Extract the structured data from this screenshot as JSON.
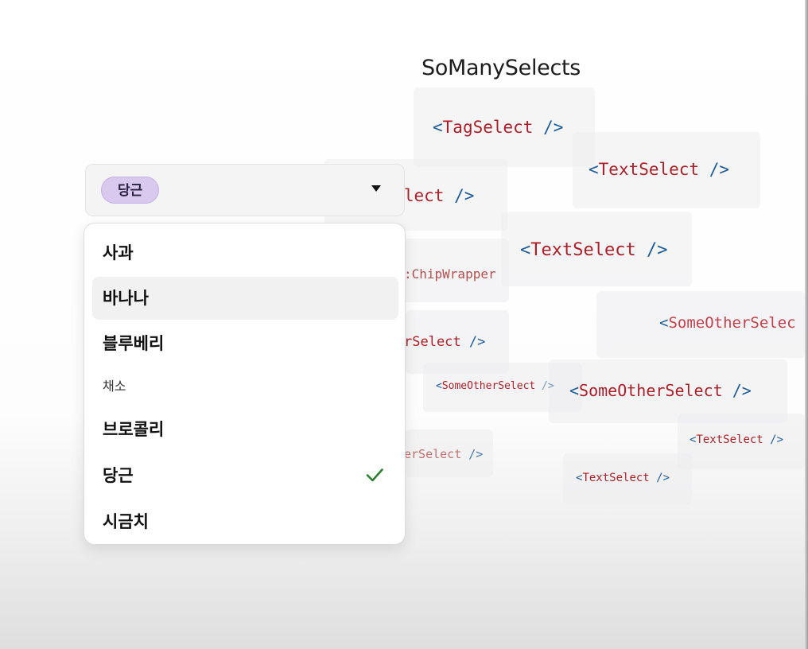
{
  "page_title": "SoManySelects",
  "select": {
    "selected_chip": "당근",
    "menu_items": [
      {
        "label": "사과",
        "kind": "option",
        "selected": false
      },
      {
        "label": "바나나",
        "kind": "option",
        "selected": false
      },
      {
        "label": "블루베리",
        "kind": "option",
        "selected": false
      },
      {
        "label": "채소",
        "kind": "group",
        "selected": false
      },
      {
        "label": "브로콜리",
        "kind": "option",
        "selected": false
      },
      {
        "label": "당근",
        "kind": "option",
        "selected": true
      },
      {
        "label": "시금치",
        "kind": "option",
        "selected": false
      }
    ],
    "hovered_item": "바나나"
  },
  "code_labels": {
    "open": "<",
    "close": " />",
    "tag_select": "TagSelect",
    "text_select": "TextSelect",
    "chip_wrapper": "ChipWrapper",
    "some_other_select": "SomeOtherSelect",
    "some_other_selec_cut": "SomeOtherSelec",
    "cut_er_select": "rSelect",
    "cut_er_select_2": "erSelect",
    "chip_wrapper_cut": ":ChipWrapper"
  },
  "colors": {
    "bracket": "#1f5c94",
    "tag_name": "#a8202a",
    "chip_bg": "#d9c9ef",
    "check": "#2e7d32",
    "hover_bg": "#f1f1f2"
  },
  "icons": {
    "check": "check-icon",
    "dropdown": "caret-down-icon"
  }
}
